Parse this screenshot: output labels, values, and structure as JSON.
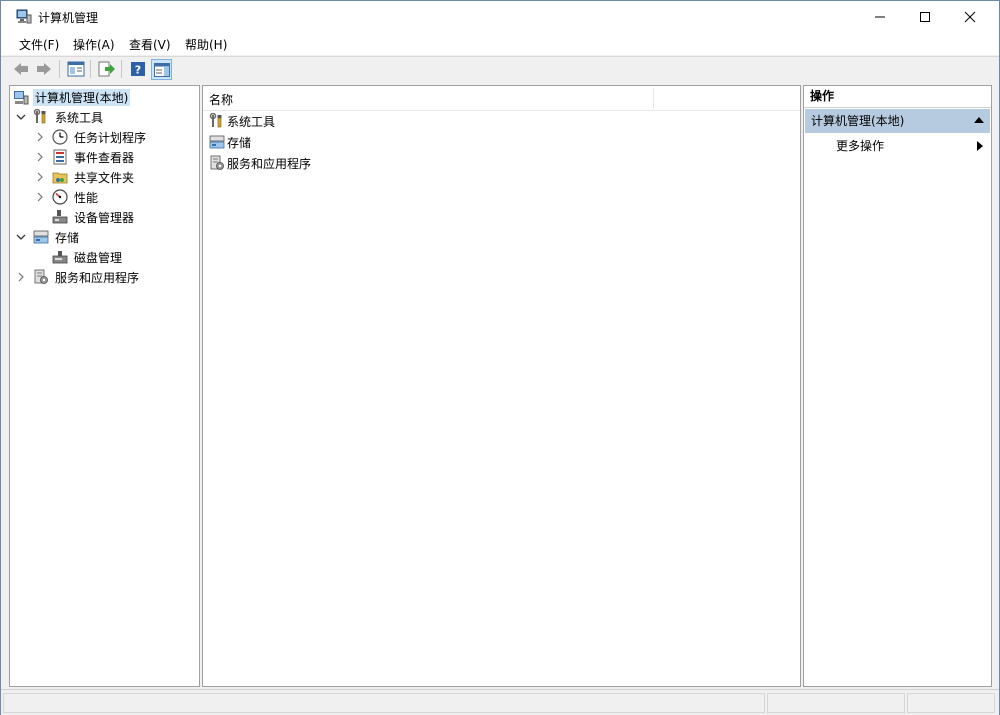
{
  "window": {
    "title": "计算机管理"
  },
  "menu": [
    "文件(F)",
    "操作(A)",
    "查看(V)",
    "帮助(H)"
  ],
  "tree": [
    {
      "label": "计算机管理(本地)",
      "icon": "computer-management-icon",
      "level": 0,
      "expander": "none",
      "selected": true
    },
    {
      "label": "系统工具",
      "icon": "tools-icon",
      "level": 0,
      "expander": "expanded"
    },
    {
      "label": "任务计划程序",
      "icon": "clock-icon",
      "level": 1,
      "expander": "collapsed"
    },
    {
      "label": "事件查看器",
      "icon": "event-viewer-icon",
      "level": 1,
      "expander": "collapsed"
    },
    {
      "label": "共享文件夹",
      "icon": "shared-folder-icon",
      "level": 1,
      "expander": "collapsed"
    },
    {
      "label": "性能",
      "icon": "performance-icon",
      "level": 1,
      "expander": "collapsed"
    },
    {
      "label": "设备管理器",
      "icon": "device-manager-icon",
      "level": 1,
      "expander": "none"
    },
    {
      "label": "存储",
      "icon": "storage-icon",
      "level": 0,
      "expander": "expanded"
    },
    {
      "label": "磁盘管理",
      "icon": "disk-icon",
      "level": 1,
      "expander": "none"
    },
    {
      "label": "服务和应用程序",
      "icon": "services-icon",
      "level": 0,
      "expander": "collapsed"
    }
  ],
  "list": {
    "column": "名称",
    "items": [
      {
        "label": "系统工具",
        "icon": "tools-icon"
      },
      {
        "label": "存储",
        "icon": "storage-icon"
      },
      {
        "label": "服务和应用程序",
        "icon": "services-icon"
      }
    ]
  },
  "actions": {
    "header": "操作",
    "group": "计算机管理(本地)",
    "item": "更多操作"
  }
}
